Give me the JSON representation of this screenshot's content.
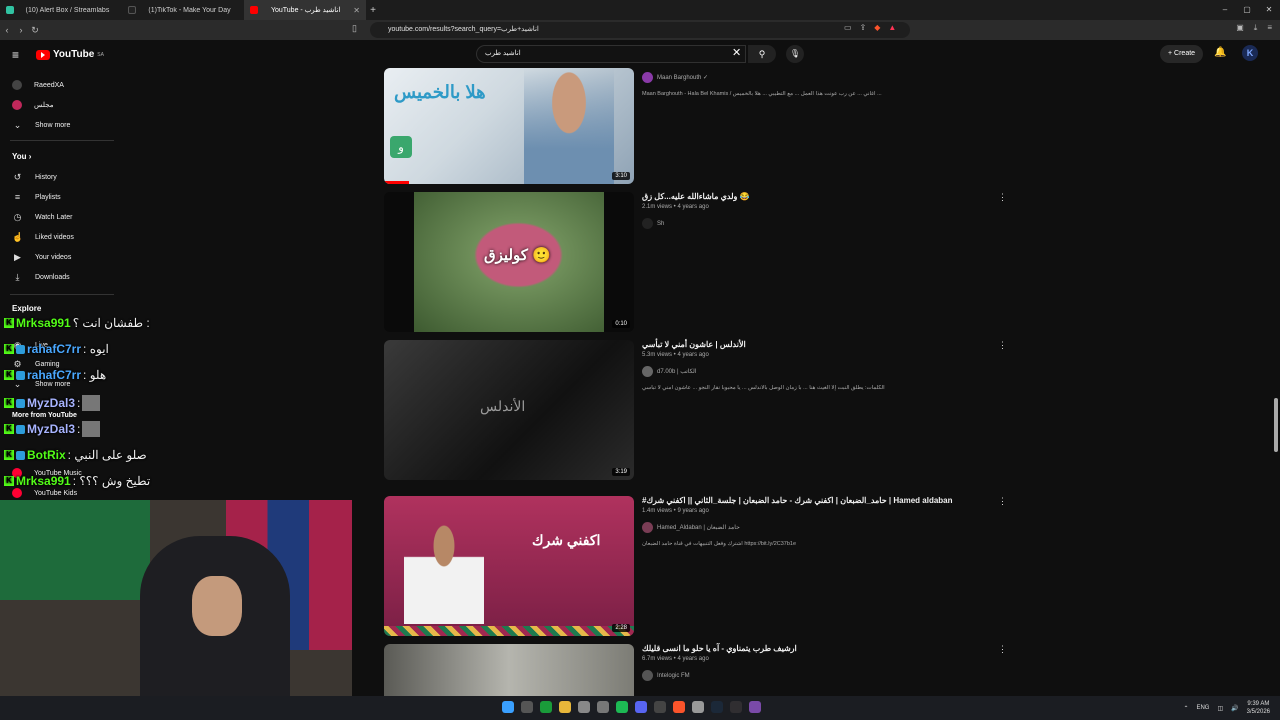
{
  "browser": {
    "tabs": [
      {
        "label": "(10) Alert Box / Streamlabs",
        "color": "#31c3a2"
      },
      {
        "label": "(1)TikTok - Make Your Day",
        "color": "#222222"
      },
      {
        "label": "YouTube - اناشيد طرب",
        "color": "#ff0000"
      }
    ],
    "url": "youtube.com/results?search_query=اناشيد+طرب"
  },
  "youtube": {
    "logo": "YouTube",
    "logo_region": "SA",
    "search_value": "اناشيد طرب",
    "create_label": "Create",
    "avatar_letter": "K"
  },
  "sidebar": {
    "subs": [
      {
        "label": "RaeedXA",
        "color": "#444444"
      },
      {
        "label": "مجلس",
        "color": "#c0285b"
      },
      {
        "label": "Show more"
      }
    ],
    "you_heading": "You",
    "you_items": [
      {
        "label": "History",
        "icon": "history-icon",
        "glyph": "↺"
      },
      {
        "label": "Playlists",
        "icon": "playlist-icon",
        "glyph": "≡"
      },
      {
        "label": "Watch Later",
        "icon": "clock-icon",
        "glyph": "◷"
      },
      {
        "label": "Liked videos",
        "icon": "thumbs-up-icon",
        "glyph": "👍"
      },
      {
        "label": "Your videos",
        "icon": "video-icon",
        "glyph": "▶"
      },
      {
        "label": "Downloads",
        "icon": "download-icon",
        "glyph": "⤓"
      }
    ],
    "explore_heading": "Explore",
    "explore_items": [
      "Live",
      "Gaming",
      "Show more"
    ],
    "more_heading": "More from YouTube",
    "more_items": [
      "YouTube Music",
      "YouTube Kids"
    ]
  },
  "videos": [
    {
      "title": "",
      "stats": "",
      "channel": "Maan Barghouth ✓",
      "desc": "Maan Barghouth - Hala Bel Khamis / أغاني ... عن رب عونت هذا العمل ... مع التطيبي ... هلا بالخميس ...",
      "duration": "3:10",
      "thumb_text": "هلا بالخميس",
      "thumb_color": "#4aa6c8"
    },
    {
      "title": "ولدي ماشاءالله عليه...كل زق 😂",
      "stats": "2.1m views • 4 years ago",
      "channel": "Sh",
      "desc": "",
      "duration": "0:10",
      "thumb_text": "كوليزق 🙂",
      "thumb_color": "#5c8a4a"
    },
    {
      "title": "الأندلس | عاشون أمني لا تبأسي",
      "stats": "5.3m views • 4 years ago",
      "channel": "d7.00b | الكاتب",
      "desc": "الكلمات: يطلق النبت إلا الغيث هنا ... با زمان الوصل بالأندلس ... يا محبوبا نقار النجو ... عاشون أمني لا تبأسي",
      "duration": "3:19",
      "thumb_text": "الأندلس",
      "thumb_color": "#2a2a2a"
    },
    {
      "title": "#حامد_الضبعان | اكفني شرك - حامد الضبعان | جلسة_الثاني || اكفني شرك | Hamed aldaban",
      "stats": "1.4m views • 9 years ago",
      "channel": "Hamed_Aldaban | حامد الضبعان",
      "desc": "اشترك وفعل التنبيهات في قناة حامد الضبعان https://bit.ly/2C37b1e",
      "duration": "2:28",
      "thumb_text": "اكفني شرك",
      "thumb_color": "#a3325b"
    },
    {
      "title": "ارشيف طرب يتمناوي - آه يا حلو ما انسى قليلك",
      "stats": "6.7m views • 4 years ago",
      "channel": "Intelogic FM",
      "desc": "",
      "duration": "",
      "thumb_text": "",
      "thumb_color": "#8a8a86"
    }
  ],
  "chat": [
    {
      "user": "Mrksa991",
      "msg": "طفشان انت ؟ :",
      "color": "#53fc18",
      "badges": 1
    },
    {
      "user": "rahafC7rr",
      "msg": ": ايوه",
      "color": "#4aa8ff",
      "badges": 2
    },
    {
      "user": "rahafC7rr",
      "msg": ": هلو",
      "color": "#4aa8ff",
      "badges": 2
    },
    {
      "user": "MyzDal3",
      "msg": ":",
      "color": "#a8b4ff",
      "badges": 2
    },
    {
      "user": "MyzDal3",
      "msg": ":",
      "color": "#a8b4ff",
      "badges": 2
    },
    {
      "user": "BotRix",
      "msg": ": صلو على النبي",
      "color": "#53fc18",
      "badges": 3
    },
    {
      "user": "Mrksa991",
      "msg": ": تطيخ وش ؟؟؟",
      "color": "#53fc18",
      "badges": 1
    }
  ],
  "taskbar": {
    "lang": "ENG",
    "time": "9:39 AM",
    "date": "3/5/2026"
  }
}
